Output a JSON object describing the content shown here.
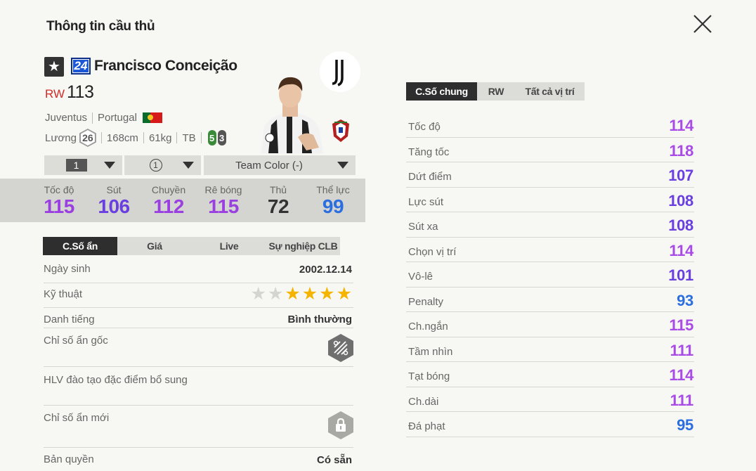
{
  "header": {
    "title": "Thông tin cầu thủ"
  },
  "player": {
    "season_badge": "24",
    "name": "Francisco Conceição",
    "position": "RW",
    "ovr": "113",
    "club": "Juventus",
    "nation": "Portugal",
    "salary_label": "Lương",
    "salary": "26",
    "height": "168cm",
    "weight": "61kg",
    "body_type": "TB",
    "weak_foot_left": "5",
    "weak_foot_right": "3",
    "icons": {
      "star": "star-icon",
      "club": "juventus-logo-icon",
      "nation": "portugal-crest-icon",
      "close": "close-icon"
    }
  },
  "selectors": {
    "level": "1",
    "position_count": "1",
    "team_color": "Team Color (-)"
  },
  "main_stats": [
    {
      "label": "Tốc độ",
      "value": "115",
      "color": "#9b40e0"
    },
    {
      "label": "Sút",
      "value": "106",
      "color": "#6a3fe0"
    },
    {
      "label": "Chuyền",
      "value": "112",
      "color": "#9b40e0"
    },
    {
      "label": "Rê bóng",
      "value": "115",
      "color": "#9b40e0"
    },
    {
      "label": "Thủ",
      "value": "72",
      "color": "#333333"
    },
    {
      "label": "Thể lực",
      "value": "99",
      "color": "#2a6ee0"
    }
  ],
  "left_tabs": [
    "C.Số ẩn",
    "Giá",
    "Live",
    "Sự nghiệp CLB"
  ],
  "hidden_info": {
    "birth_label": "Ngày sinh",
    "birth_value": "2002.12.14",
    "skill_label": "Kỹ thuật",
    "skill_stars": 4,
    "skill_stars_max": 6,
    "fame_label": "Danh tiếng",
    "fame_value": "Bình thường",
    "base_traits_label": "Chỉ số ẩn gốc",
    "coach_traits_label": "HLV đào tạo đặc điểm bổ sung",
    "new_traits_label": "Chỉ số ẩn mới",
    "license_label": "Bản quyền",
    "license_value": "Có sẵn"
  },
  "right_tabs": [
    "C.Số chung",
    "RW",
    "Tất cả vị trí"
  ],
  "attributes": [
    {
      "label": "Tốc độ",
      "value": "114",
      "color": "#a94be6"
    },
    {
      "label": "Tăng tốc",
      "value": "118",
      "color": "#a94be6"
    },
    {
      "label": "Dứt điểm",
      "value": "107",
      "color": "#6a3fe0"
    },
    {
      "label": "Lực sút",
      "value": "108",
      "color": "#6a3fe0"
    },
    {
      "label": "Sút xa",
      "value": "108",
      "color": "#6a3fe0"
    },
    {
      "label": "Chọn vị trí",
      "value": "114",
      "color": "#a94be6"
    },
    {
      "label": "Vô-lê",
      "value": "101",
      "color": "#6a3fe0"
    },
    {
      "label": "Penalty",
      "value": "93",
      "color": "#2a6ee0"
    },
    {
      "label": "Ch.ngắn",
      "value": "115",
      "color": "#a94be6"
    },
    {
      "label": "Tầm nhìn",
      "value": "111",
      "color": "#a94be6"
    },
    {
      "label": "Tạt bóng",
      "value": "114",
      "color": "#a94be6"
    },
    {
      "label": "Ch.dài",
      "value": "111",
      "color": "#a94be6"
    },
    {
      "label": "Đá phạt",
      "value": "95",
      "color": "#2a6ee0"
    }
  ]
}
